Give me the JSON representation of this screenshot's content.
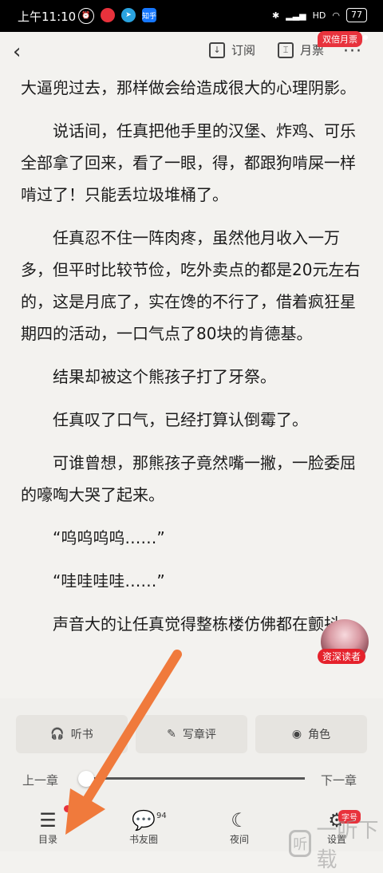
{
  "status_bar": {
    "time": "上午11:10",
    "app_icon_label": "知乎",
    "battery": "77",
    "network": "HD"
  },
  "toolbar": {
    "back_icon": "chevron-left",
    "subscribe_label": "订阅",
    "monthly_ticket_label": "月票",
    "double_ticket_badge": "双倍月票",
    "more_icon": "more-dots"
  },
  "content": {
    "paragraphs": [
      {
        "text": "大逼兜过去，那样做会给造成很大的心理阴影。",
        "indent": false
      },
      {
        "text": "说话间，任真把他手里的汉堡、炸鸡、可乐全部拿了回来，看了一眼，得，都跟狗啃屎一样啃过了！只能丢垃圾堆桶了。",
        "indent": true
      },
      {
        "text": "任真忍不住一阵肉疼，虽然他月收入一万多，但平时比较节俭，吃外卖点的都是20元左右的，这是月底了，实在馋的不行了，借着疯狂星期四的活动，一口气点了80块的肯德基。",
        "indent": true
      },
      {
        "text": "结果却被这个熊孩子打了牙祭。",
        "indent": true
      },
      {
        "text": "任真叹了口气，已经打算认倒霉了。",
        "indent": true
      },
      {
        "text": "可谁曾想，那熊孩子竟然嘴一撇，一脸委屈的嚎啕大哭了起来。",
        "indent": true
      },
      {
        "text": "“呜呜呜呜……”",
        "indent": true
      },
      {
        "text": "“哇哇哇哇……”",
        "indent": true
      },
      {
        "text": "声音大的让任真觉得整栋楼仿佛都在颤抖。",
        "indent": true
      }
    ],
    "reader_badge": "资深读者"
  },
  "actions": {
    "listen": "听书",
    "write_review": "写章评",
    "character": "角色"
  },
  "chapter_nav": {
    "prev": "上一章",
    "next": "下一章",
    "progress": 0
  },
  "bottom_nav": {
    "toc": "目录",
    "book_circle": "书友圈",
    "book_circle_count": "94",
    "night": "夜间",
    "settings": "设置",
    "font_badge": "字号"
  },
  "watermark": {
    "icon": "听",
    "text": "一听下载"
  },
  "colors": {
    "accent_red": "#e8323c",
    "arrow_orange": "#f07a3c",
    "page_bg": "#f3f2ef"
  }
}
